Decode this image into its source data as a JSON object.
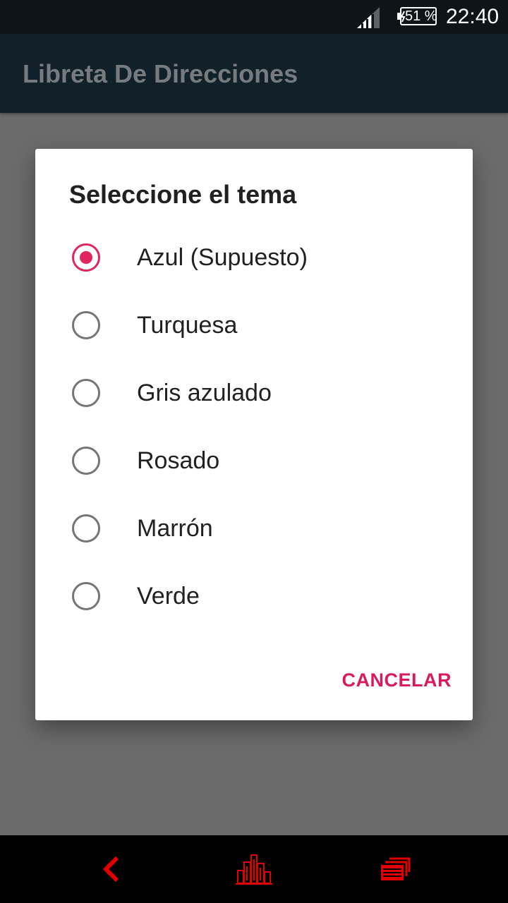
{
  "status_bar": {
    "battery": "51 %",
    "time": "22:40"
  },
  "app_bar": {
    "title": "Libreta De Direcciones"
  },
  "dialog": {
    "title": "Seleccione el tema",
    "options": [
      {
        "label": "Azul (Supuesto)",
        "checked": true
      },
      {
        "label": "Turquesa",
        "checked": false
      },
      {
        "label": "Gris azulado",
        "checked": false
      },
      {
        "label": "Rosado",
        "checked": false
      },
      {
        "label": "Marrón",
        "checked": false
      },
      {
        "label": "Verde",
        "checked": false
      }
    ],
    "cancel_label": "CANCELAR"
  },
  "nav_bar": {
    "icons": [
      "back-icon",
      "home-icon",
      "recents-icon"
    ]
  },
  "colors": {
    "accent": "#e0255f",
    "nav_icon": "#e00000",
    "app_bar": "#12202a",
    "status_bar": "#0d1519",
    "scrim_background": "#6b6b6b"
  }
}
